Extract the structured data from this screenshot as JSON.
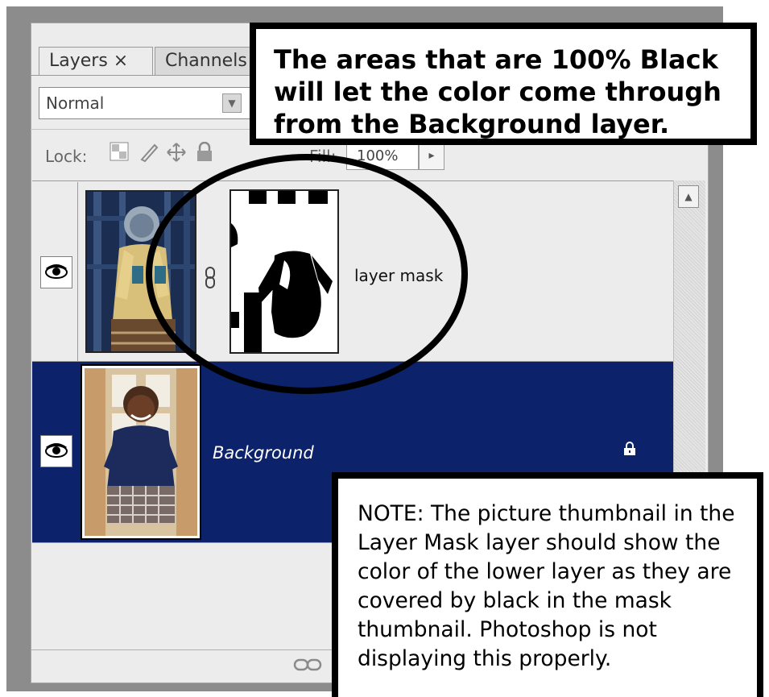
{
  "tabs": {
    "layers_label": "Layers ×",
    "channels_label": "Channels"
  },
  "blend_mode": {
    "value": "Normal"
  },
  "lock": {
    "label": "Lock:",
    "icons": [
      "transparency-lock-icon",
      "brush-lock-icon",
      "move-lock-icon",
      "padlock-icon"
    ]
  },
  "fill": {
    "label": "Fill:",
    "value": "100%"
  },
  "layers": [
    {
      "name": "layer mask",
      "visible": true,
      "has_mask": true
    },
    {
      "name": "Background",
      "visible": true,
      "selected": true,
      "locked": true
    }
  ],
  "callouts": {
    "top": "The areas that are 100% Black will let the color come through from the Background layer.",
    "bottom": "NOTE:  The picture thumbnail in the Layer Mask layer should show the color of the lower layer as they are covered by black in the mask thumbnail.  Photoshop is not displaying this properly."
  },
  "colors": {
    "selected_row": "#0c226a",
    "panel_bg": "#ececec",
    "frame": "#8c8c8c"
  }
}
